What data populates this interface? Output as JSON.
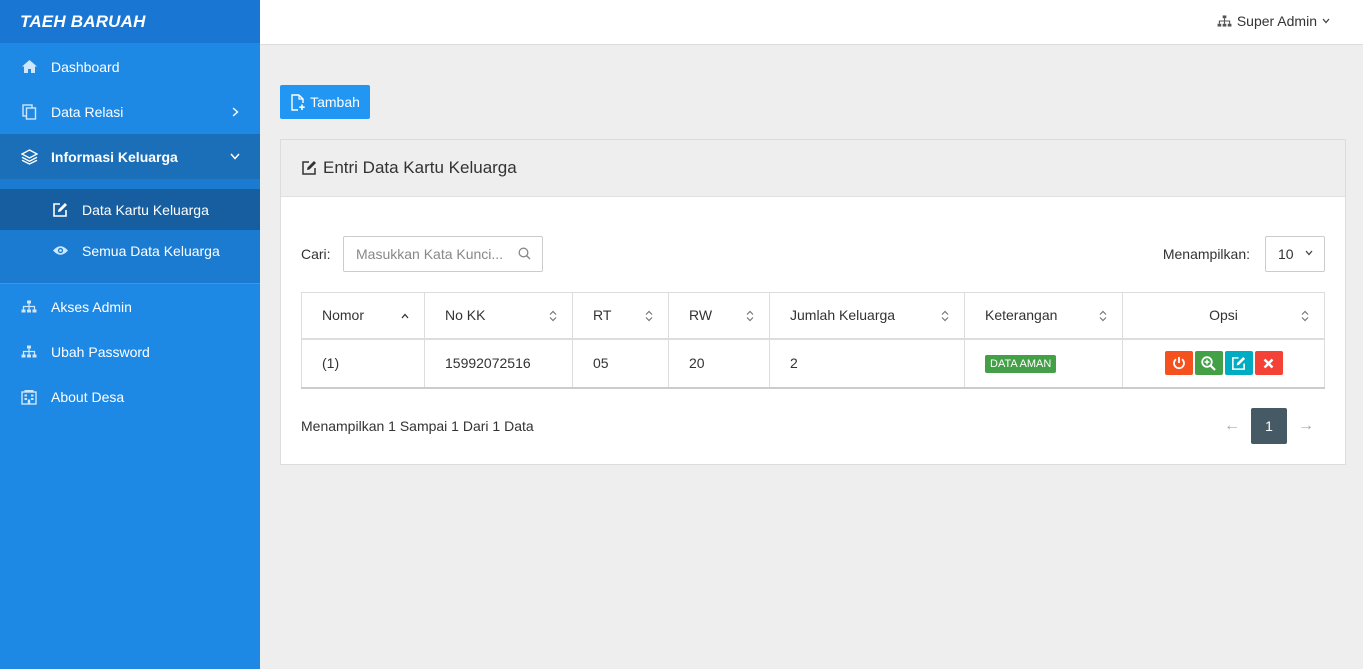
{
  "brand": "TAEH BARUAH",
  "sidebar": {
    "items": [
      {
        "label": "Dashboard",
        "icon": "home-icon"
      },
      {
        "label": "Data Relasi",
        "icon": "copy-icon"
      },
      {
        "label": "Informasi Keluarga",
        "icon": "layers-icon"
      },
      {
        "label": "Akses Admin",
        "icon": "sitemap-icon"
      },
      {
        "label": "Ubah Password",
        "icon": "sitemap-icon"
      },
      {
        "label": "About Desa",
        "icon": "building-icon"
      }
    ],
    "submenu": [
      {
        "label": "Data Kartu Keluarga",
        "icon": "edit-icon"
      },
      {
        "label": "Semua Data Keluarga",
        "icon": "eye-icon"
      }
    ]
  },
  "topbar": {
    "user": "Super Admin"
  },
  "main": {
    "add_button": "Tambah",
    "card_title": "Entri Data Kartu Keluarga",
    "search_label": "Cari:",
    "search_placeholder": "Masukkan Kata Kunci...",
    "show_label": "Menampilkan:",
    "page_size": "10",
    "table": {
      "columns": [
        "Nomor",
        "No KK",
        "RT",
        "RW",
        "Jumlah Keluarga",
        "Keterangan",
        "Opsi"
      ],
      "rows": [
        {
          "nomor": "(1)",
          "no_kk": "15992072516",
          "rt": "05",
          "rw": "20",
          "jumlah": "2",
          "keterangan": "DATA AMAN"
        }
      ]
    },
    "info": "Menampilkan 1 Sampai 1 Dari 1 Data",
    "pagination": {
      "prev": "←",
      "current": "1",
      "next": "→"
    }
  },
  "colors": {
    "sidebar": "#1e88e5",
    "primary": "#2196f3",
    "badge_green": "#43a047",
    "op_power": "#f4511e",
    "op_zoom": "#43a047",
    "op_edit": "#00acc1",
    "op_delete": "#f44336",
    "pager_active": "#455a64"
  }
}
